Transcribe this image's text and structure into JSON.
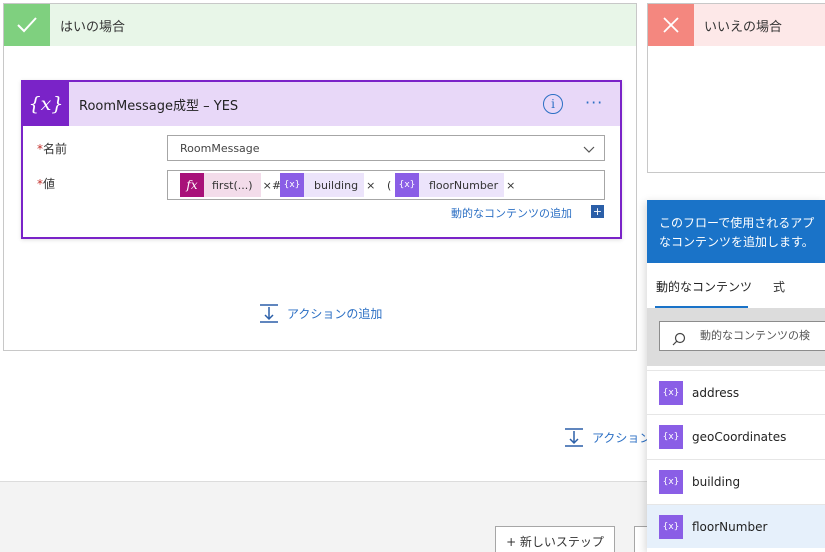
{
  "yes_branch": {
    "title": "はいの場合"
  },
  "no_branch": {
    "title": "いいえの場合"
  },
  "action_card": {
    "icon_text": "{x}",
    "title": "RoomMessage成型 – YES",
    "info_label": "i",
    "more_label": "···",
    "name_field": {
      "required_mark": "*",
      "label": "名前",
      "value": "RoomMessage"
    },
    "value_field": {
      "required_mark": "*",
      "label": "値",
      "tokens": [
        {
          "icon": "fx",
          "text": "first(...)",
          "remove": "×"
        },
        {
          "icon": "{x}",
          "text": "building",
          "remove": "×"
        },
        {
          "icon": "{x}",
          "text": "floorNumber",
          "remove": "×"
        }
      ],
      "separators": [
        "#",
        "("
      ]
    },
    "dynamic_link": "動的なコンテンツの追加",
    "dynamic_plus": "+"
  },
  "add_action_label": "アクションの追加",
  "add_action_label_2": "アクション",
  "new_step_label": "+ 新しいステップ",
  "dynamic_panel": {
    "header_line1": "このフローで使用されるアプ",
    "header_line2": "なコンテンツを追加します。",
    "tabs": [
      "動的なコンテンツ",
      "式"
    ],
    "search_placeholder": "動的なコンテンツの検",
    "items": [
      {
        "label": "address"
      },
      {
        "label": "geoCoordinates"
      },
      {
        "label": "building"
      },
      {
        "label": "floorNumber"
      }
    ],
    "selected_item": "floorNumber"
  },
  "colors": {
    "accent": "#7a23c8",
    "link": "#2b6fc4",
    "yes": "#7fd07f",
    "no": "#f4877f",
    "panel_header": "#1a73c8"
  }
}
